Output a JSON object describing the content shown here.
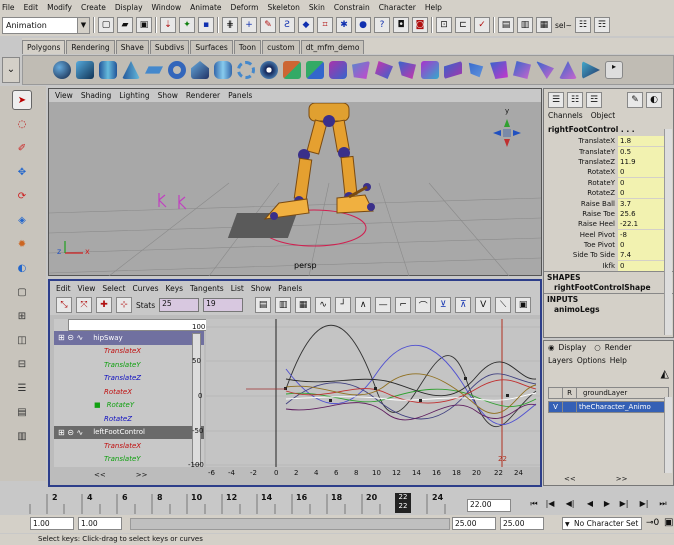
{
  "menubar": {
    "items": [
      "File",
      "Edit",
      "Modify",
      "Create",
      "Display",
      "Window",
      "Animate",
      "Deform",
      "Skeleton",
      "Skin",
      "Constrain",
      "Character",
      "Help"
    ]
  },
  "statusline": {
    "mode": "Animation",
    "sel_label": "sel~"
  },
  "shelf": {
    "tabs": [
      "Polygons",
      "Rendering",
      "Shave",
      "Subdivs",
      "Surfaces",
      "Toon",
      "custom",
      "dt_mfm_demo"
    ],
    "active_tab": 0
  },
  "viewport": {
    "menu": [
      "View",
      "Shading",
      "Lighting",
      "Show",
      "Renderer",
      "Panels"
    ],
    "camera_label": "persp",
    "axis_y": "y",
    "axis_z": "z",
    "axis_x": "x"
  },
  "graph_editor": {
    "menu": [
      "Edit",
      "View",
      "Select",
      "Curves",
      "Keys",
      "Tangents",
      "List",
      "Show",
      "Panels"
    ],
    "stats_label": "Stats",
    "stats_a": "25",
    "stats_b": "19",
    "outliner": [
      {
        "label": "hipSway",
        "kind": "node"
      },
      {
        "label": "TranslateX",
        "kind": "red"
      },
      {
        "label": "TranslateY",
        "kind": "green"
      },
      {
        "label": "TranslateZ",
        "kind": "blue"
      },
      {
        "label": "RotateX",
        "kind": "red"
      },
      {
        "label": "RotateY",
        "kind": "green"
      },
      {
        "label": "RotateZ",
        "kind": "blue"
      },
      {
        "label": "leftFootControl",
        "kind": "node2"
      },
      {
        "label": "TranslateX",
        "kind": "red"
      },
      {
        "label": "TranslateY",
        "kind": "green"
      }
    ],
    "y_ticks": [
      "100",
      "50",
      "0",
      "-50",
      "-100"
    ],
    "x_ticks": [
      "-6",
      "-4",
      "-2",
      "0",
      "2",
      "4",
      "6",
      "8",
      "10",
      "12",
      "14",
      "16",
      "18",
      "20",
      "22",
      "24"
    ],
    "current_frame_label": "22"
  },
  "channel_box": {
    "tabs": [
      "Channels",
      "Object"
    ],
    "object_name": "rightFootControl . . .",
    "attributes": [
      {
        "name": "TranslateX",
        "value": "1.8"
      },
      {
        "name": "TranslateY",
        "value": "0.5"
      },
      {
        "name": "TranslateZ",
        "value": "11.9"
      },
      {
        "name": "RotateX",
        "value": "0"
      },
      {
        "name": "RotateY",
        "value": "0"
      },
      {
        "name": "RotateZ",
        "value": "0"
      },
      {
        "name": "Raise Ball",
        "value": "3.7"
      },
      {
        "name": "Raise Toe",
        "value": "25.6"
      },
      {
        "name": "Raise Heel",
        "value": "-22.1"
      },
      {
        "name": "Heel Pivot",
        "value": "-8"
      },
      {
        "name": "Toe Pivot",
        "value": "0"
      },
      {
        "name": "Side To Side",
        "value": "7.4"
      },
      {
        "name": "Ikfk",
        "value": "0"
      }
    ],
    "shapes_header": "SHAPES",
    "shape_name": "rightFootControlShape",
    "inputs_header": "INPUTS",
    "input_name": "animoLegs"
  },
  "layers": {
    "display_label": "Display",
    "render_label": "Render",
    "menu": [
      "Layers",
      "Options",
      "Help"
    ],
    "items": [
      {
        "flag1": "",
        "flag2": "R",
        "name": "groundLayer",
        "selected": false
      },
      {
        "flag1": "V",
        "flag2": "",
        "name": "theCharacter_Animo",
        "selected": true
      }
    ]
  },
  "timeslider": {
    "frames": [
      "2",
      "4",
      "6",
      "8",
      "10",
      "12",
      "14",
      "16",
      "18",
      "20",
      "24"
    ],
    "current_top": "22",
    "current_bottom": "22",
    "current_frame_field": "22.00"
  },
  "rangebar": {
    "start": "1.00",
    "inner_start": "1.00",
    "inner_end": "25.00",
    "end": "25.00",
    "character_set": "No Character Set"
  },
  "helpline": {
    "text": "Select keys: Click-drag to select keys or curves"
  }
}
